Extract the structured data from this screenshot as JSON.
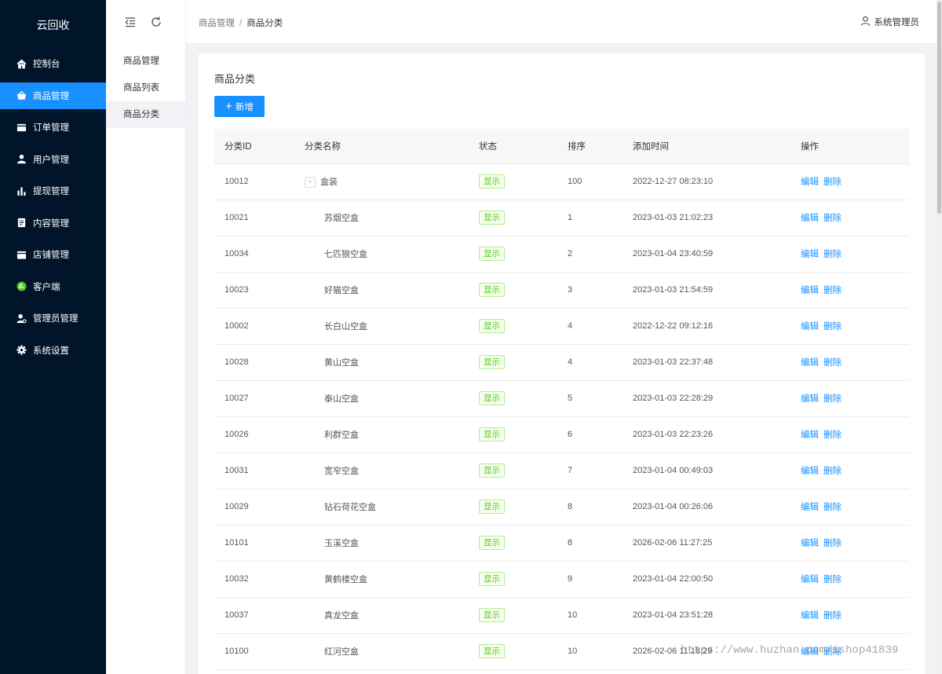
{
  "app": {
    "logo": "云回收"
  },
  "sidebar": {
    "items": [
      {
        "label": "控制台",
        "icon": "home-icon"
      },
      {
        "label": "商品管理",
        "icon": "basket-icon",
        "active": true
      },
      {
        "label": "订单管理",
        "icon": "order-icon"
      },
      {
        "label": "用户管理",
        "icon": "user-icon"
      },
      {
        "label": "提现管理",
        "icon": "bar-chart-icon"
      },
      {
        "label": "内容管理",
        "icon": "document-icon"
      },
      {
        "label": "店铺管理",
        "icon": "shop-icon"
      },
      {
        "label": "客户端",
        "icon": "mini-program-icon"
      },
      {
        "label": "管理员管理",
        "icon": "admin-icon"
      },
      {
        "label": "系统设置",
        "icon": "gear-icon"
      }
    ]
  },
  "submenu": {
    "title": "商品管理",
    "items": [
      {
        "label": "商品列表"
      },
      {
        "label": "商品分类",
        "active": true
      }
    ]
  },
  "header": {
    "breadcrumb": [
      "商品管理",
      "商品分类"
    ],
    "separator": "/",
    "user": "系统管理员"
  },
  "main": {
    "title": "商品分类",
    "add_button": "新增",
    "table": {
      "columns": [
        "分类ID",
        "分类名称",
        "状态",
        "排序",
        "添加时间",
        "操作"
      ],
      "toggle_symbol": "-",
      "rows": [
        {
          "id": "10012",
          "name": "盒装",
          "status": "显示",
          "sort": "100",
          "time": "2022-12-27 08:23:10",
          "parent": true
        },
        {
          "id": "10021",
          "name": "苏烟空盒",
          "status": "显示",
          "sort": "1",
          "time": "2023-01-03 21:02:23"
        },
        {
          "id": "10034",
          "name": "七匹狼空盒",
          "status": "显示",
          "sort": "2",
          "time": "2023-01-04 23:40:59"
        },
        {
          "id": "10023",
          "name": "好猫空盒",
          "status": "显示",
          "sort": "3",
          "time": "2023-01-03 21:54:59"
        },
        {
          "id": "10002",
          "name": "长白山空盒",
          "status": "显示",
          "sort": "4",
          "time": "2022-12-22 09:12:16"
        },
        {
          "id": "10028",
          "name": "黄山空盒",
          "status": "显示",
          "sort": "4",
          "time": "2023-01-03 22:37:48"
        },
        {
          "id": "10027",
          "name": "泰山空盒",
          "status": "显示",
          "sort": "5",
          "time": "2023-01-03 22:28:29"
        },
        {
          "id": "10026",
          "name": "利群空盒",
          "status": "显示",
          "sort": "6",
          "time": "2023-01-03 22:23:26"
        },
        {
          "id": "10031",
          "name": "宽窄空盒",
          "status": "显示",
          "sort": "7",
          "time": "2023-01-04 00:49:03"
        },
        {
          "id": "10029",
          "name": "钻石荷花空盒",
          "status": "显示",
          "sort": "8",
          "time": "2023-01-04 00:26:06"
        },
        {
          "id": "10101",
          "name": "玉溪空盒",
          "status": "显示",
          "sort": "8",
          "time": "2026-02-06 11:27:25"
        },
        {
          "id": "10032",
          "name": "黄鹤楼空盒",
          "status": "显示",
          "sort": "9",
          "time": "2023-01-04 22:00:50"
        },
        {
          "id": "10037",
          "name": "真龙空盒",
          "status": "显示",
          "sort": "10",
          "time": "2023-01-04 23:51:28"
        },
        {
          "id": "10100",
          "name": "红河空盒",
          "status": "显示",
          "sort": "10",
          "time": "2026-02-06 11:18:29"
        }
      ],
      "actions": {
        "edit": "编辑",
        "delete": "删除"
      }
    }
  },
  "watermark": "https://www.huzhan.com/ishop41839",
  "colors": {
    "sidebar_bg": "#001529",
    "accent": "#1890ff",
    "status_green": "#52c41a"
  }
}
